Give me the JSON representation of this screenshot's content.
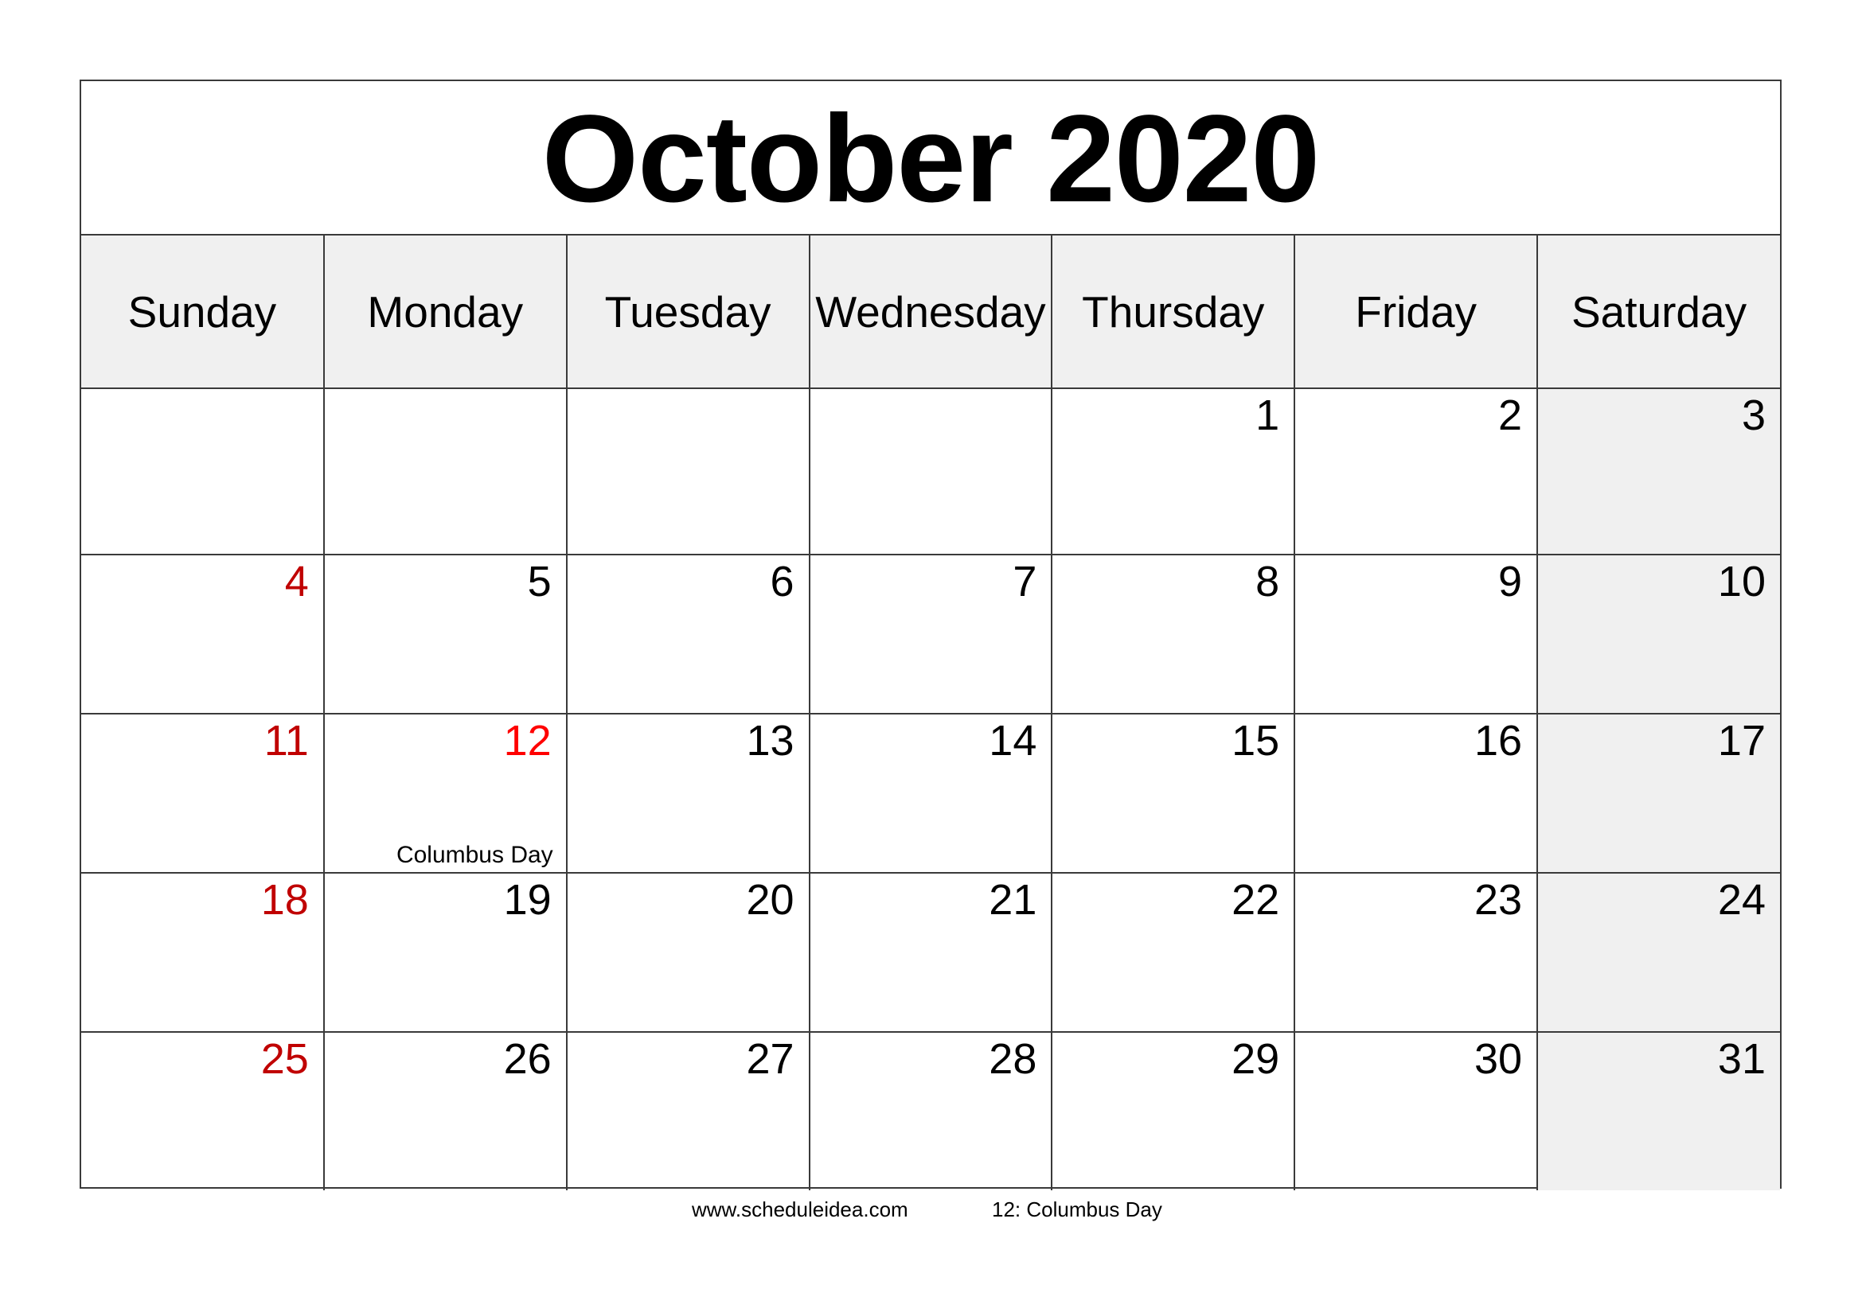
{
  "calendar": {
    "title": "October 2020",
    "colors": {
      "border": "#3a3a3a",
      "header_bg": "#f0f0f0",
      "saturday_bg": "#f0f0f0",
      "sunday_text": "#c00000",
      "holiday_text": "#ff0000",
      "text": "#000000"
    },
    "weekdays": [
      "Sunday",
      "Monday",
      "Tuesday",
      "Wednesday",
      "Thursday",
      "Friday",
      "Saturday"
    ],
    "weeks": [
      [
        "",
        "",
        "",
        "",
        "1",
        "2",
        "3"
      ],
      [
        "4",
        "5",
        "6",
        "7",
        "8",
        "9",
        "10"
      ],
      [
        "11",
        "12",
        "13",
        "14",
        "15",
        "16",
        "17"
      ],
      [
        "18",
        "19",
        "20",
        "21",
        "22",
        "23",
        "24"
      ],
      [
        "25",
        "26",
        "27",
        "28",
        "29",
        "30",
        "31"
      ]
    ],
    "holidays": [
      {
        "day": "12",
        "name": "Columbus Day"
      }
    ]
  },
  "footer": {
    "website": "www.scheduleidea.com",
    "holiday_note": "12: Columbus Day"
  }
}
